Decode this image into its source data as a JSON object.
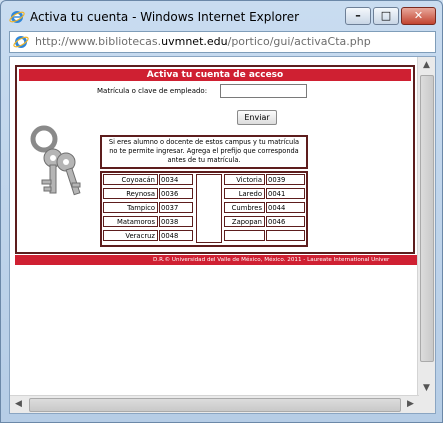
{
  "window": {
    "title": "Activa tu cuenta - Windows Internet Explorer",
    "controls": {
      "minimize": "–",
      "maximize": "□",
      "close": "✕"
    }
  },
  "address": {
    "url_prefix": "http://www.bibliotecas.",
    "url_domain": "uvmnet.edu",
    "url_path": "/portico/gui/activaCta.php"
  },
  "page": {
    "heading": "Activa tu cuenta de acceso",
    "matricula_label": "Matrícula o clave de empleado:",
    "matricula_value": "",
    "send_label": "Enviar",
    "info_text": "Si eres alumno o docente de estos campus y tu matrícula no te permite ingresar. Agrega el prefijo que corresponda antes de tu matrícula.",
    "campuses_left": [
      {
        "campus": "Coyoacán",
        "prefix": "0034"
      },
      {
        "campus": "Reynosa",
        "prefix": "0036"
      },
      {
        "campus": "Tampico",
        "prefix": "0037"
      },
      {
        "campus": "Matamoros",
        "prefix": "0038"
      },
      {
        "campus": "Veracruz",
        "prefix": "0048"
      }
    ],
    "campuses_right": [
      {
        "campus": "Victoria",
        "prefix": "0039"
      },
      {
        "campus": "Laredo",
        "prefix": "0041"
      },
      {
        "campus": "Cumbres",
        "prefix": "0044"
      },
      {
        "campus": "Zapopan",
        "prefix": "0046"
      }
    ],
    "footer": "D.R.© Universidad del Valle de México, México. 2011 - Laureate International Univer"
  },
  "colors": {
    "accent": "#cf2032",
    "border": "#5d1d1d"
  },
  "icons": {
    "browser": "ie-icon",
    "keys": "keys-icon"
  }
}
